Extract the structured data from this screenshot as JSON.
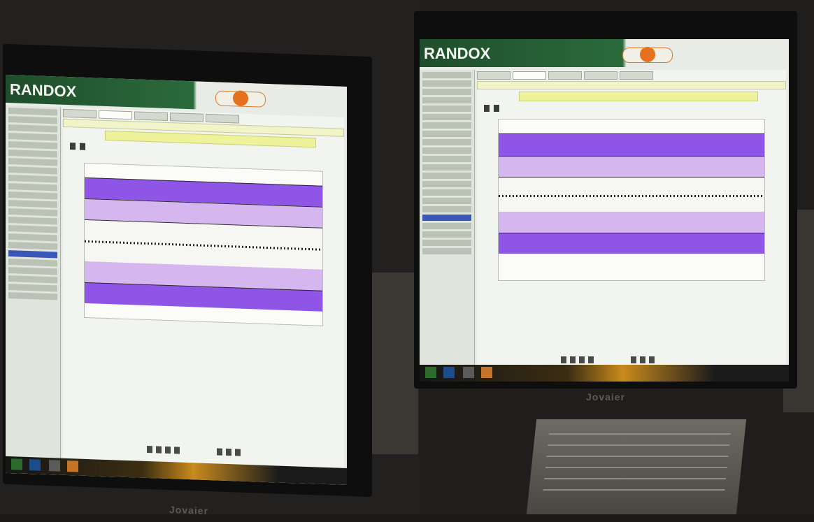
{
  "photo": {
    "monitors": [
      {
        "side": "left",
        "brand": "Jovaier",
        "app": {
          "logo_text": "RANDOX"
        }
      },
      {
        "side": "right",
        "brand": "Jovaier",
        "app": {
          "logo_text": "RANDOX"
        }
      }
    ],
    "chart": {
      "type": "levey-jennings",
      "bands": [
        "purple",
        "light-purple",
        "white",
        "light-purple",
        "purple"
      ]
    },
    "colors": {
      "band_deep": "#8e55e6",
      "band_light": "#d5b6ef",
      "header_green": "#1f4d2b",
      "accent_orange": "#e5701e"
    }
  }
}
